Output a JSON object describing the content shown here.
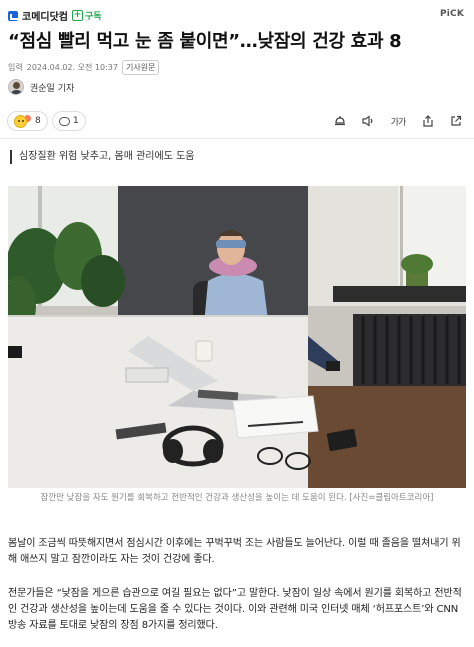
{
  "header": {
    "brand_name": "코메디닷컴",
    "subscribe_label": "구독",
    "pick_label": "PiCK"
  },
  "article": {
    "headline": "“점심 빨리 먹고 눈 좀 붙이면”…낮잠의 건강 효과 8",
    "meta_prefix": "입력",
    "date": "2024.04.02. 오전 10:37",
    "original_tag": "기사원문",
    "reporter": "권순일 기자",
    "reaction_count": "8",
    "comment_count": "1",
    "subheading": "심장질환 위험 낮추고, 몸매 관리에도 도움",
    "image_caption": "잠깐만 낮잠을 자도 원기를 회복하고 전반적인 건강과 생산성을 높이는 데 도움이 된다. [사진=클립아트코리아]",
    "paragraphs": [
      "봄날이 조금씩 따뜻해지면서 점심시간 이후에는 꾸벅꾸벅 조는 사람들도 늘어난다. 이럴 때 졸음을 떨쳐내기 위해 애쓰지 말고 잠깐이라도 자는 것이 건강에 좋다.",
      "전문가들은 “낮잠을 게으른 습관으로 여길 필요는 없다”고 말한다. 낮잠이 일상 속에서 원기를 회복하고 전반적인 건강과 생산성을 높이는데 도움을 줄 수 있다는 것이다. 이와 관련해 미국 인터넷 매체 ‘허프포스트’와 CNN 방송 자료를 토대로 낮잠의 장점 8가지를 정리했다."
    ]
  },
  "toolbar": {
    "font_size_label": "가가"
  },
  "icons": [
    "summary-icon",
    "audio-icon",
    "font-size-icon",
    "share-icon",
    "more-icon"
  ],
  "colors": {
    "brand_blue": "#1a66d8",
    "subscribe_green": "#1fa64a"
  }
}
